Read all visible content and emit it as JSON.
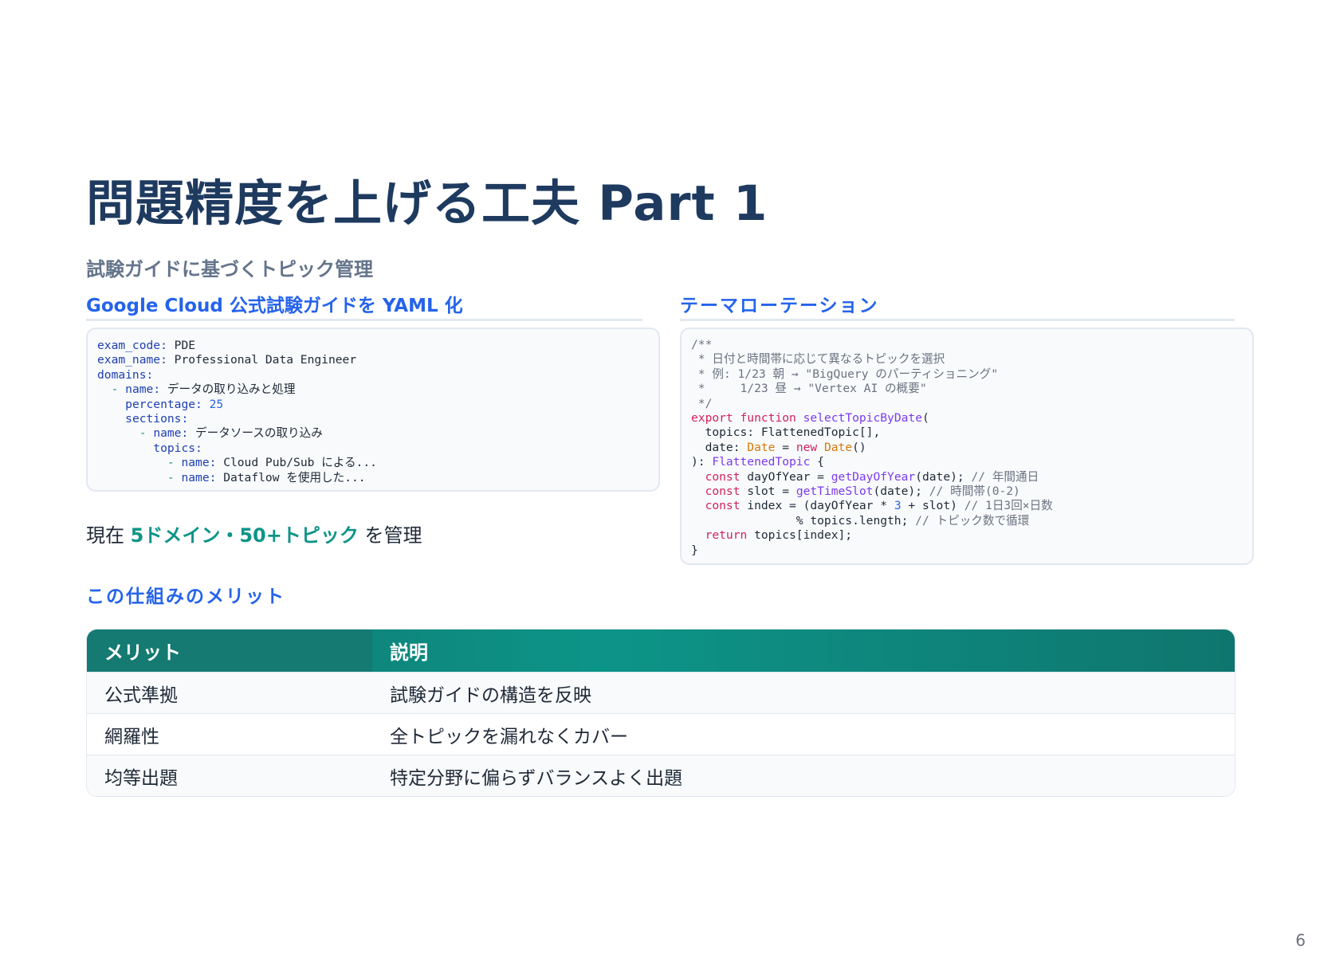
{
  "slide": {
    "title": "問題精度を上げる工夫 Part 1",
    "subtitle": "試験ガイドに基づくトピック管理",
    "page_number": "6"
  },
  "left": {
    "heading": "Google Cloud 公式試験ガイドを YAML 化",
    "yaml": {
      "exam_code_key": "exam_code:",
      "exam_code_val": " PDE",
      "exam_name_key": "exam_name:",
      "exam_name_val": " Professional Data Engineer",
      "domains_key": "domains:",
      "domain_name_key": "name:",
      "domain_name_val": " データの取り込みと処理",
      "percentage_key": "percentage:",
      "percentage_val": " 25",
      "sections_key": "sections:",
      "section_name_key": "name:",
      "section_name_val": " データソースの取り込み",
      "topics_key": "topics:",
      "topic1_key": "name:",
      "topic1_val": " Cloud Pub/Sub による...",
      "topic2_key": "name:",
      "topic2_val": " Dataflow を使用した..."
    },
    "summary_prefix": "現在 ",
    "summary_highlight": "5ドメイン・50+トピック",
    "summary_suffix": " を管理"
  },
  "right": {
    "heading": "テーマローテーション",
    "code": {
      "c1": "/**",
      "c2": " * 日付と時間帯に応じて異なるトピックを選択",
      "c3": " * 例: 1/23 朝 → \"BigQuery のパーティショニング\"",
      "c4": " *     1/23 昼 → \"Vertex AI の概要\"",
      "c5": " */",
      "export": "export",
      "function": "function",
      "fn_name": "selectTopicByDate",
      "open_paren": "(",
      "topics_param": "  topics: FlattenedTopic[],",
      "date_param": "  date: ",
      "date_type": "Date",
      "eq": " = ",
      "new_kw": "new",
      "date_ctor": "Date",
      "date_end": "()",
      "ret_open": "): ",
      "ret_type": "FlattenedTopic",
      "ret_brace": " {",
      "const": "const",
      "day_decl": " dayOfYear = ",
      "day_fn": "getDayOfYear",
      "day_rest": "(date); ",
      "day_comment": "// 年間通日",
      "slot_decl": " slot = ",
      "slot_fn": "getTimeSlot",
      "slot_rest": "(date); ",
      "slot_comment": "// 時間帯(0-2)",
      "idx_decl": " index = (dayOfYear * ",
      "idx_num": "3",
      "idx_rest": " + slot) ",
      "idx_comment": "// 1日3回×日数",
      "mod_line": "               % topics.length; ",
      "mod_comment": "// トピック数で循環",
      "return_kw": "return",
      "return_rest": " topics[index];",
      "close": "}"
    }
  },
  "merits": {
    "heading": "この仕組みのメリット",
    "headers": [
      "メリット",
      "説明"
    ],
    "rows": [
      [
        "公式準拠",
        "試験ガイドの構造を反映"
      ],
      [
        "網羅性",
        "全トピックを漏れなくカバー"
      ],
      [
        "均等出題",
        "特定分野に偏らずバランスよく出題"
      ]
    ]
  }
}
